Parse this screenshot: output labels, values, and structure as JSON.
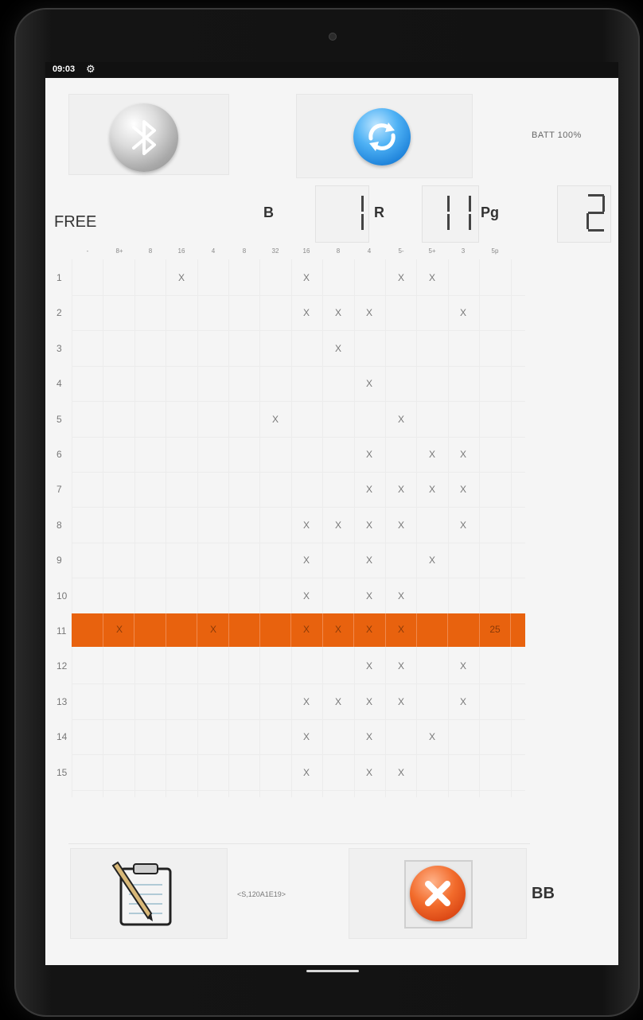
{
  "status_bar": {
    "time": "09:03",
    "settings_icon": "gear-icon"
  },
  "header": {
    "bluetooth_icon": "bluetooth-icon",
    "sync_icon": "sync-icon",
    "battery": "BATT 100%"
  },
  "scoreboard": {
    "mode": "FREE",
    "b_label": "B",
    "b_value": "1",
    "r_label": "R",
    "r_value": "11",
    "pg_label": "Pg",
    "pg_value": "2"
  },
  "table": {
    "columns": [
      "-",
      "8+",
      "8",
      "16",
      "4",
      "8",
      "32",
      "16",
      "8",
      "4",
      "5-",
      "5+",
      "3",
      "5p"
    ],
    "rows": [
      {
        "num": "1",
        "marks": [
          3,
          7,
          10,
          11
        ]
      },
      {
        "num": "2",
        "marks": [
          7,
          8,
          9,
          12
        ]
      },
      {
        "num": "3",
        "marks": [
          8
        ]
      },
      {
        "num": "4",
        "marks": [
          9
        ]
      },
      {
        "num": "5",
        "marks": [
          6,
          10
        ]
      },
      {
        "num": "6",
        "marks": [
          9,
          11,
          12
        ]
      },
      {
        "num": "7",
        "marks": [
          9,
          10,
          11,
          12
        ]
      },
      {
        "num": "8",
        "marks": [
          7,
          8,
          9,
          10,
          12
        ]
      },
      {
        "num": "9",
        "marks": [
          7,
          9,
          11
        ]
      },
      {
        "num": "10",
        "marks": [
          7,
          9,
          10
        ]
      },
      {
        "num": "11",
        "marks": [
          1,
          4,
          7,
          8,
          9,
          10
        ],
        "highlight": true,
        "total": "25"
      },
      {
        "num": "12",
        "marks": [
          9,
          10,
          12
        ]
      },
      {
        "num": "13",
        "marks": [
          7,
          8,
          9,
          10,
          12
        ]
      },
      {
        "num": "14",
        "marks": [
          7,
          9,
          11
        ]
      },
      {
        "num": "15",
        "marks": [
          7,
          9,
          10
        ]
      }
    ],
    "mark": "X",
    "highlight_color": "#e8620e"
  },
  "footer": {
    "clipboard_icon": "clipboard-icon",
    "code": "<S,120A1E19>",
    "cancel_icon": "cancel-icon",
    "bb_label": "BB"
  }
}
